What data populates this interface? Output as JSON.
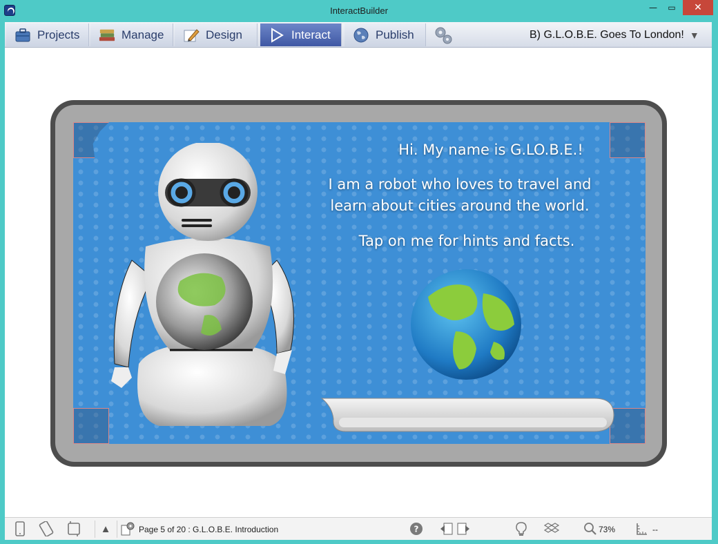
{
  "window": {
    "title": "InteractBuilder",
    "min_glyph": "—",
    "max_glyph": "▭",
    "close_glyph": "✕"
  },
  "tabs": [
    {
      "label": "Projects",
      "icon": "briefcase-icon"
    },
    {
      "label": "Manage",
      "icon": "books-icon"
    },
    {
      "label": "Design",
      "icon": "pencil-icon"
    },
    {
      "label": "Interact",
      "icon": "play-icon",
      "active": true
    },
    {
      "label": "Publish",
      "icon": "globe-icon"
    }
  ],
  "project": {
    "name": "B)  G.L.O.B.E. Goes To London!",
    "chevron": "▼"
  },
  "page": {
    "greeting": "Hi. My name is G.LO.B.E.!",
    "intro_line1": "I am a robot who loves to travel and",
    "intro_line2": "learn about cities around the world.",
    "hint": "Tap on me for hints and facts."
  },
  "status": {
    "page_info": "Page 5 of 20 : G.L.O.B.E. Introduction",
    "zoom": "73%",
    "position": "--",
    "up_glyph": "▲",
    "help_glyph": "?"
  },
  "colors": {
    "accent": "#3f58a4",
    "screen_bg": "#3e8fd6",
    "window_chrome": "#4ecac7",
    "close": "#c7473a"
  }
}
